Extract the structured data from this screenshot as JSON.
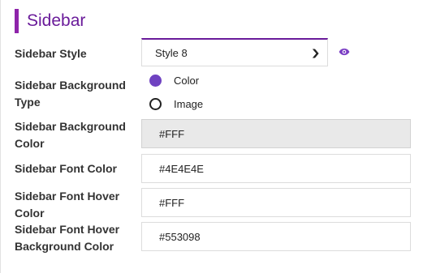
{
  "section": {
    "title": "Sidebar"
  },
  "sidebar_style": {
    "label": "Sidebar Style",
    "selected": "Style 8"
  },
  "background_type": {
    "label": "Sidebar Background Type",
    "options": [
      {
        "label": "Color",
        "checked": true
      },
      {
        "label": "Image",
        "checked": false
      }
    ]
  },
  "background_color": {
    "label": "Sidebar Background Color",
    "value": "#FFF"
  },
  "font_color": {
    "label": "Sidebar Font Color",
    "value": "#4E4E4E"
  },
  "font_hover_color": {
    "label": "Sidebar Font Hover Color",
    "value": "#FFF"
  },
  "font_hover_bg_color": {
    "label": "Sidebar Font Hover Background Color",
    "value": "#553098"
  },
  "icons": {
    "preview": "eye-icon",
    "dropdown": "chevron-down-icon"
  },
  "colors": {
    "accent": "#8e24aa",
    "title": "#6a1b9a",
    "radio": "#6f42c1"
  }
}
